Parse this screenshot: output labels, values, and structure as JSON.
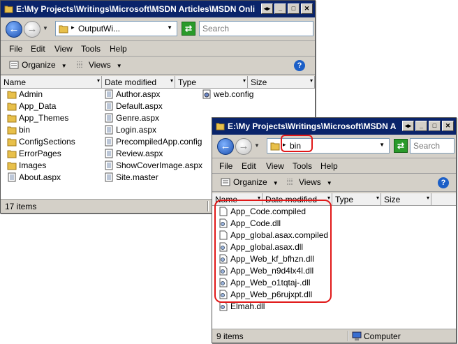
{
  "window1": {
    "title": "E:\\My Projects\\Writings\\Microsoft\\MSDN Articles\\MSDN Onli",
    "address_path": "OutputWi...",
    "search_placeholder": "Search",
    "menu": [
      "File",
      "Edit",
      "View",
      "Tools",
      "Help"
    ],
    "toolbar": {
      "organize_label": "Organize",
      "views_label": "Views"
    },
    "columns": [
      "Name",
      "Date modified",
      "Type",
      "Size"
    ],
    "items_col1": [
      {
        "label": "Admin",
        "kind": "folder"
      },
      {
        "label": "App_Data",
        "kind": "folder"
      },
      {
        "label": "App_Themes",
        "kind": "folder"
      },
      {
        "label": "bin",
        "kind": "folder"
      },
      {
        "label": "ConfigSections",
        "kind": "folder"
      },
      {
        "label": "ErrorPages",
        "kind": "folder"
      },
      {
        "label": "Images",
        "kind": "folder"
      },
      {
        "label": "About.aspx",
        "kind": "page"
      }
    ],
    "items_col2": [
      {
        "label": "Author.aspx",
        "kind": "page"
      },
      {
        "label": "Default.aspx",
        "kind": "page"
      },
      {
        "label": "Genre.aspx",
        "kind": "page"
      },
      {
        "label": "Login.aspx",
        "kind": "page"
      },
      {
        "label": "PrecompiledApp.config",
        "kind": "page"
      },
      {
        "label": "Review.aspx",
        "kind": "page"
      },
      {
        "label": "ShowCoverImage.aspx",
        "kind": "page"
      },
      {
        "label": "Site.master",
        "kind": "page"
      }
    ],
    "items_col3": [
      {
        "label": "web.config",
        "kind": "config"
      }
    ],
    "status": "17 items"
  },
  "window2": {
    "title": "E:\\My Projects\\Writings\\Microsoft\\MSDN A",
    "address_path": "bin",
    "search_placeholder": "Search",
    "menu": [
      "File",
      "Edit",
      "View",
      "Tools",
      "Help"
    ],
    "toolbar": {
      "organize_label": "Organize",
      "views_label": "Views"
    },
    "columns": [
      "Name",
      "Date modified",
      "Type",
      "Size"
    ],
    "items": [
      {
        "label": "App_Code.compiled",
        "kind": "file"
      },
      {
        "label": "App_Code.dll",
        "kind": "dll"
      },
      {
        "label": "App_global.asax.compiled",
        "kind": "file"
      },
      {
        "label": "App_global.asax.dll",
        "kind": "dll"
      },
      {
        "label": "App_Web_kf_bfhzn.dll",
        "kind": "dll"
      },
      {
        "label": "App_Web_n9d4lx4l.dll",
        "kind": "dll"
      },
      {
        "label": "App_Web_o1tqtaj-.dll",
        "kind": "dll"
      },
      {
        "label": "App_Web_p6rujxpt.dll",
        "kind": "dll"
      },
      {
        "label": "Elmah.dll",
        "kind": "dll"
      }
    ],
    "status": "9 items",
    "status_zone": "Computer"
  },
  "colors": {
    "titlebar": "#0a246a",
    "highlight": "#e01818",
    "folder": "#e8c04a"
  }
}
